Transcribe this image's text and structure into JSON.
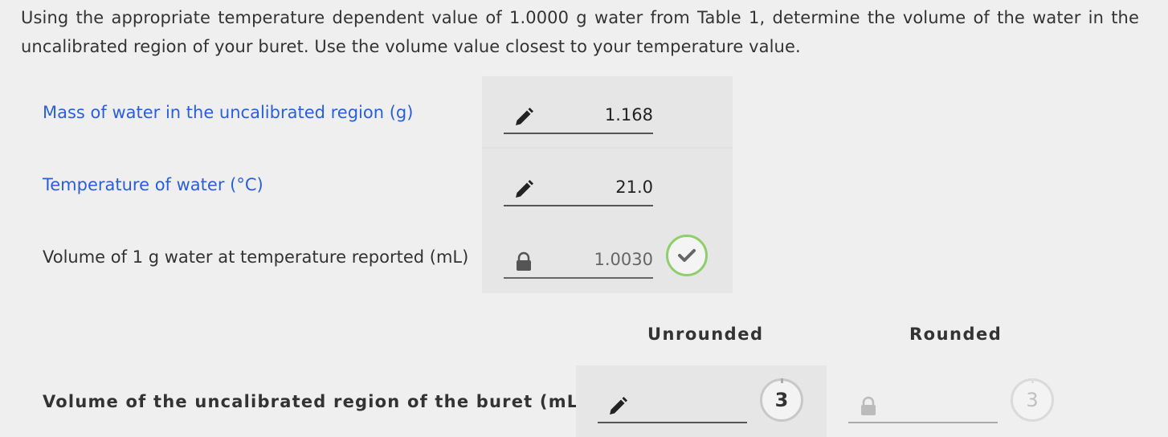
{
  "instructions": "Using the appropriate temperature dependent value of 1.0000 g water from Table 1, determine the volume of the water in the uncalibrated region of your buret. Use the volume value closest to your temperature value.",
  "rows": [
    {
      "label": "Mass of water in the uncalibrated region (g)",
      "value": "1.168",
      "state": "editable",
      "icon": "pencil-icon"
    },
    {
      "label": "Temperature of water (°C)",
      "value": "21.0",
      "state": "editable",
      "icon": "pencil-icon"
    },
    {
      "label": "Volume of 1 g water at temperature reported (mL)",
      "value": "1.0030",
      "state": "locked",
      "icon": "lock-icon",
      "status": "correct"
    }
  ],
  "columns": {
    "unrounded": "Unrounded",
    "rounded": "Rounded"
  },
  "final_row": {
    "label": "Volume of the uncalibrated region of the buret (mL)",
    "unrounded_value": "",
    "unrounded_sig_figs": "3",
    "rounded_value": "",
    "rounded_sig_figs": "3"
  },
  "colors": {
    "link": "#2b5fd9",
    "correct": "#8fce6b"
  }
}
